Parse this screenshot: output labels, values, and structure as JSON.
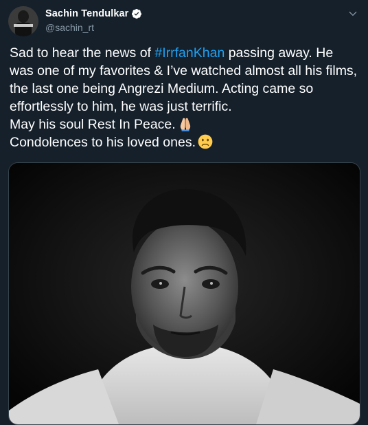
{
  "author": {
    "display_name": "Sachin Tendulkar",
    "handle": "@sachin_rt",
    "verified": true
  },
  "tweet": {
    "text_before_hashtag": "Sad to hear the news of ",
    "hashtag": "#IrrfanKhan",
    "text_after_hashtag": " passing away. He was one of my favorites & I’ve watched almost all his films, the last one being Angrezi Medium. Acting came so effortlessly to him, he was just terrific.",
    "line2": "May his soul Rest In Peace.",
    "line3": "Condolences to his loved ones."
  },
  "icons": {
    "avatar": "avatar-photo",
    "verified": "verified-badge-icon",
    "caret": "chevron-down-icon",
    "emoji1": "folded-hands-emoji",
    "emoji2": "frowning-face-emoji"
  },
  "colors": {
    "background": "#15202b",
    "link": "#1da1f2",
    "secondary_text": "#8899a6",
    "border": "#38444d"
  }
}
